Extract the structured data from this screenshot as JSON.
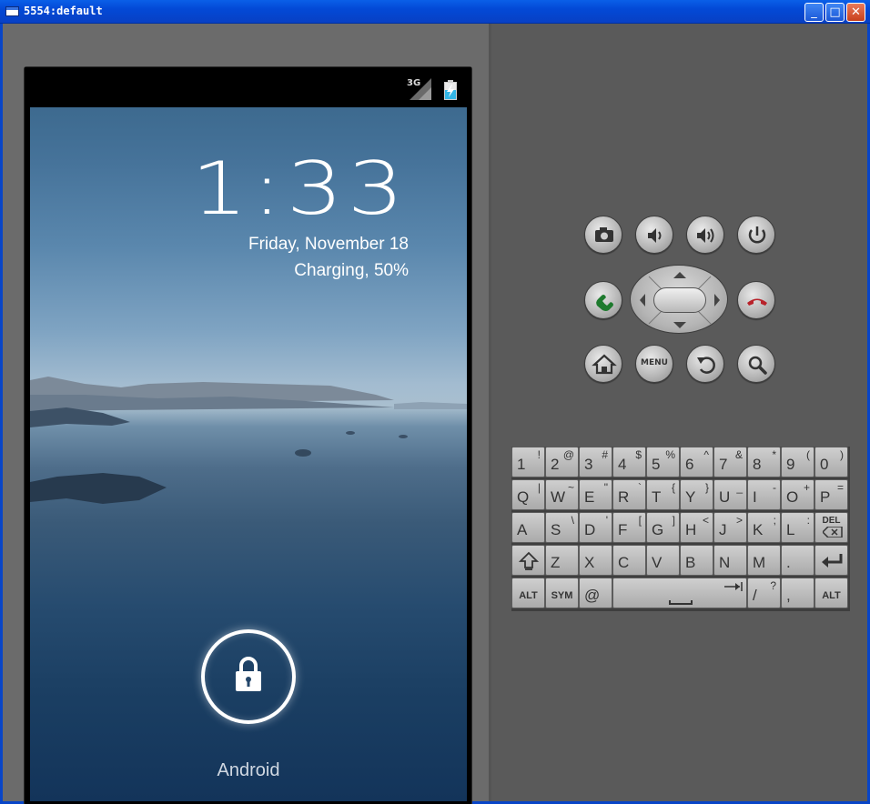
{
  "window": {
    "title": "5554:default",
    "controls": {
      "minimize": "_",
      "maximize": "□",
      "close": "✕"
    }
  },
  "statusbar": {
    "network": "3G",
    "battery_icon": "battery-charging-icon"
  },
  "lockscreen": {
    "time": "1:33",
    "date": "Friday, November 18",
    "charging": "Charging, 50%",
    "carrier": "Android",
    "lock_icon": "lock-icon"
  },
  "hardware_buttons": {
    "camera": "camera-icon",
    "volume_down": "volume-down-icon",
    "volume_up": "volume-up-icon",
    "power": "power-icon",
    "call": "call-icon",
    "end_call": "end-call-icon",
    "home": "home-icon",
    "menu": "MENU",
    "back": "back-icon",
    "search": "search-icon"
  },
  "keyboard": {
    "row1": [
      {
        "main": "1",
        "alt": "!"
      },
      {
        "main": "2",
        "alt": "@"
      },
      {
        "main": "3",
        "alt": "#"
      },
      {
        "main": "4",
        "alt": "$"
      },
      {
        "main": "5",
        "alt": "%"
      },
      {
        "main": "6",
        "alt": "^"
      },
      {
        "main": "7",
        "alt": "&"
      },
      {
        "main": "8",
        "alt": "*"
      },
      {
        "main": "9",
        "alt": "("
      },
      {
        "main": "0",
        "alt": ")"
      }
    ],
    "row2": [
      {
        "main": "Q",
        "alt": "|"
      },
      {
        "main": "W",
        "alt": "~"
      },
      {
        "main": "E",
        "alt": "\""
      },
      {
        "main": "R",
        "alt": "`"
      },
      {
        "main": "T",
        "alt": "{"
      },
      {
        "main": "Y",
        "alt": "}"
      },
      {
        "main": "U",
        "alt": "_"
      },
      {
        "main": "I",
        "alt": "-"
      },
      {
        "main": "O",
        "alt": "+"
      },
      {
        "main": "P",
        "alt": "="
      }
    ],
    "row3": [
      {
        "main": "A",
        "alt": ""
      },
      {
        "main": "S",
        "alt": "\\"
      },
      {
        "main": "D",
        "alt": "'"
      },
      {
        "main": "F",
        "alt": "["
      },
      {
        "main": "G",
        "alt": "]"
      },
      {
        "main": "H",
        "alt": "<"
      },
      {
        "main": "J",
        "alt": ">"
      },
      {
        "main": "K",
        "alt": ";"
      },
      {
        "main": "L",
        "alt": ":"
      },
      {
        "main": "DEL",
        "alt": ""
      }
    ],
    "row4": [
      {
        "main": "shift-icon",
        "alt": ""
      },
      {
        "main": "Z",
        "alt": ""
      },
      {
        "main": "X",
        "alt": ""
      },
      {
        "main": "C",
        "alt": ""
      },
      {
        "main": "V",
        "alt": ""
      },
      {
        "main": "B",
        "alt": ""
      },
      {
        "main": "N",
        "alt": ""
      },
      {
        "main": "M",
        "alt": ""
      },
      {
        "main": ".",
        "alt": ""
      },
      {
        "main": "enter-icon",
        "alt": ""
      }
    ],
    "row5": {
      "alt_left": "ALT",
      "sym": "SYM",
      "at": "@",
      "space_icon": "space-icon",
      "slash": "/",
      "slash_alt": "?",
      "comma": ",",
      "alt_right": "ALT"
    }
  }
}
